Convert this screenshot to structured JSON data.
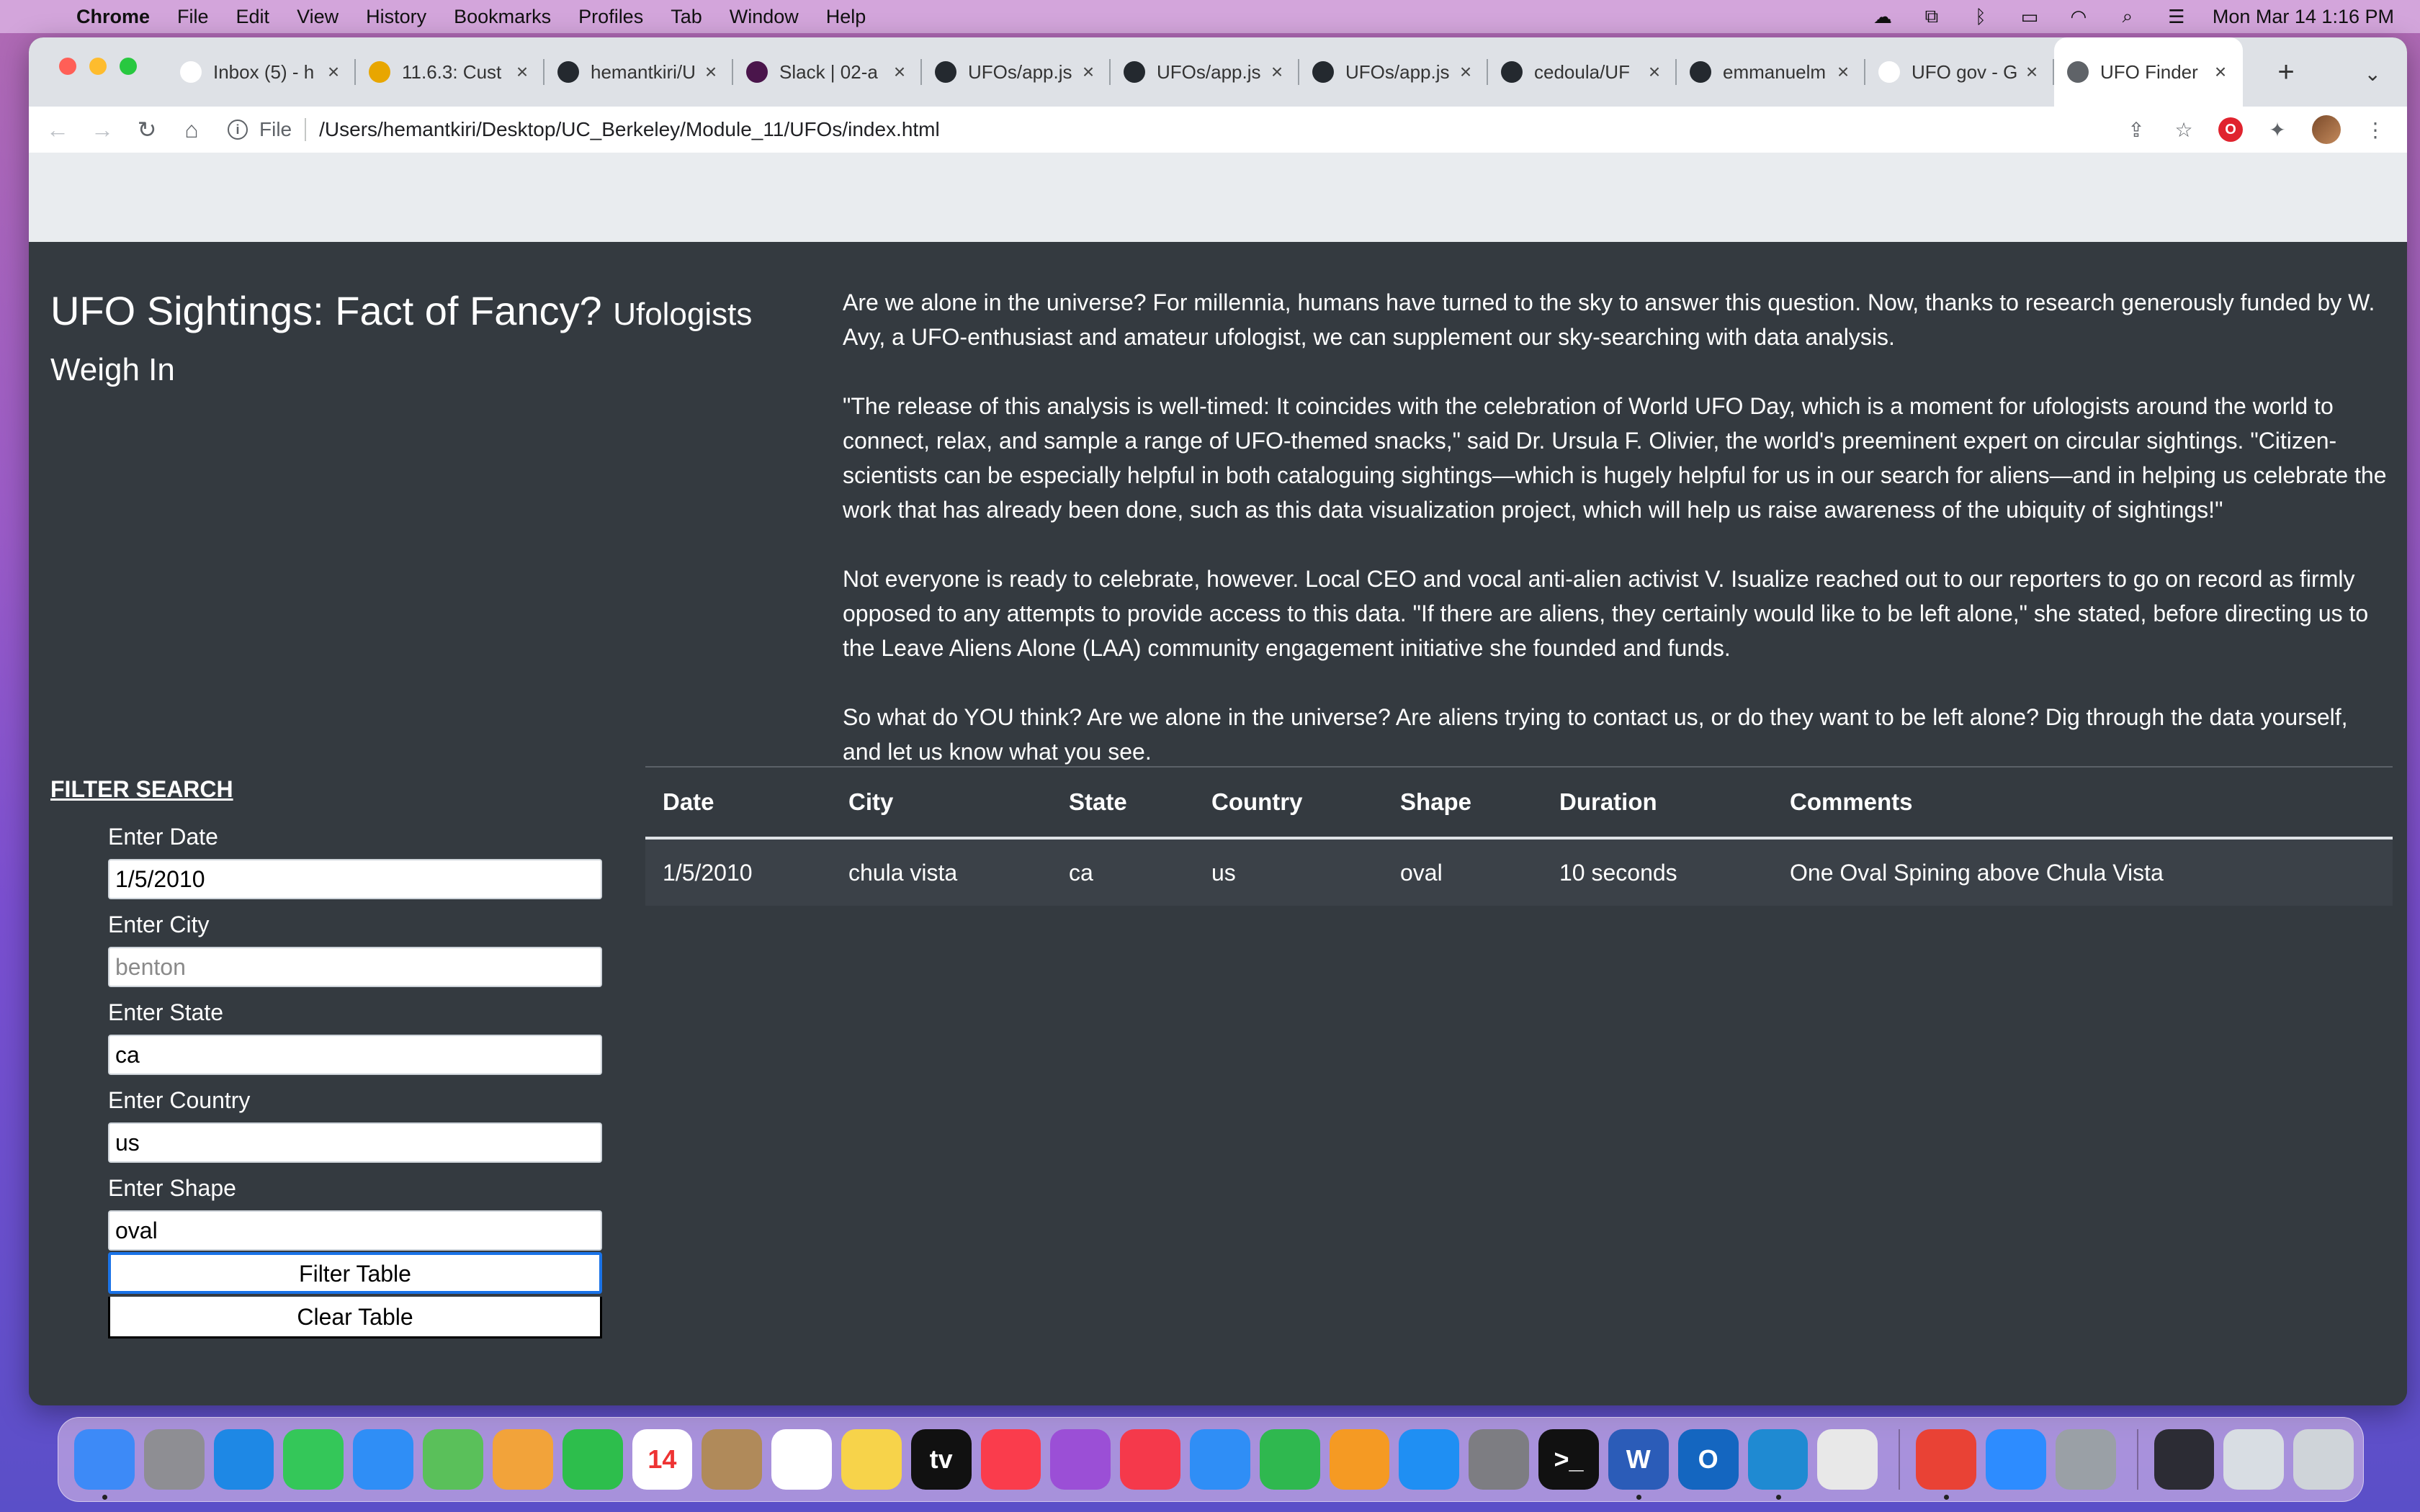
{
  "menubar": {
    "app": "Chrome",
    "items": [
      "File",
      "Edit",
      "View",
      "History",
      "Bookmarks",
      "Profiles",
      "Tab",
      "Window",
      "Help"
    ],
    "clock": "Mon Mar 14  1:16 PM"
  },
  "tabs": [
    {
      "label": "Inbox (5) - h",
      "icon": "gmail-icon",
      "color": "#ffffff"
    },
    {
      "label": "11.6.3: Cust",
      "icon": "bootcamp-icon",
      "color": "#e8a600"
    },
    {
      "label": "hemantkiri/U",
      "icon": "github-icon",
      "color": "#24292f"
    },
    {
      "label": "Slack | 02-a",
      "icon": "slack-icon",
      "color": "#4a154b"
    },
    {
      "label": "UFOs/app.js",
      "icon": "github-icon",
      "color": "#24292f"
    },
    {
      "label": "UFOs/app.js",
      "icon": "github-icon",
      "color": "#24292f"
    },
    {
      "label": "UFOs/app.js",
      "icon": "github-icon",
      "color": "#24292f"
    },
    {
      "label": "cedoula/UF",
      "icon": "github-icon",
      "color": "#24292f"
    },
    {
      "label": "emmanuelm",
      "icon": "github-icon",
      "color": "#24292f"
    },
    {
      "label": "UFO gov - G",
      "icon": "google-icon",
      "color": "#ffffff"
    },
    {
      "label": "UFO Finder",
      "icon": "globe-icon",
      "color": "#5f6368",
      "active": true
    }
  ],
  "address": {
    "scheme": "File",
    "url": "/Users/hemantkiri/Desktop/UC_Berkeley/Module_11/UFOs/index.html"
  },
  "page": {
    "title_main": "UFO Sightings: Fact of Fancy?",
    "title_sub": "Ufologists Weigh In",
    "paragraphs": [
      "Are we alone in the universe? For millennia, humans have turned to the sky to answer this question. Now, thanks to research generously funded by W. Avy, a UFO-enthusiast and amateur ufologist, we can supplement our sky-searching with data analysis.",
      "\"The release of this analysis is well-timed: It coincides with the celebration of World UFO Day, which is a moment for ufologists around the world to connect, relax, and sample a range of UFO-themed snacks,\" said Dr. Ursula F. Olivier, the world's preeminent expert on circular sightings. \"Citizen-scientists can be especially helpful in both cataloguing sightings—which is hugely helpful for us in our search for aliens—and in helping us celebrate the work that has already been done, such as this data visualization project, which will help us raise awareness of the ubiquity of sightings!\"",
      "Not everyone is ready to celebrate, however. Local CEO and vocal anti-alien activist V. Isualize reached out to our reporters to go on record as firmly opposed to any attempts to provide access to this data. \"If there are aliens, they certainly would like to be left alone,\" she stated, before directing us to the Leave Aliens Alone (LAA) community engagement initiative she founded and funds.",
      "So what do YOU think? Are we alone in the universe? Are aliens trying to contact us, or do they want to be left alone? Dig through the data yourself, and let us know what you see."
    ]
  },
  "filter": {
    "title": "FILTER SEARCH",
    "fields": [
      {
        "label": "Enter Date",
        "value": "1/5/2010",
        "placeholder": ""
      },
      {
        "label": "Enter City",
        "value": "",
        "placeholder": "benton"
      },
      {
        "label": "Enter State",
        "value": "ca",
        "placeholder": ""
      },
      {
        "label": "Enter Country",
        "value": "us",
        "placeholder": ""
      },
      {
        "label": "Enter Shape",
        "value": "oval",
        "placeholder": ""
      }
    ],
    "filter_button": "Filter Table",
    "clear_button": "Clear Table"
  },
  "table": {
    "headers": [
      "Date",
      "City",
      "State",
      "Country",
      "Shape",
      "Duration",
      "Comments"
    ],
    "rows": [
      [
        "1/5/2010",
        "chula vista",
        "ca",
        "us",
        "oval",
        "10 seconds",
        "One Oval Spining above Chula Vista"
      ]
    ]
  },
  "dock": [
    {
      "name": "finder-icon",
      "color": "#3d8af7",
      "running": true
    },
    {
      "name": "launchpad-icon",
      "color": "#8e8e93"
    },
    {
      "name": "safari-icon",
      "color": "#1e88e5"
    },
    {
      "name": "messages-icon",
      "color": "#34c759"
    },
    {
      "name": "mail-icon",
      "color": "#2f8ef6"
    },
    {
      "name": "maps-icon",
      "color": "#5ac05a"
    },
    {
      "name": "photos-icon",
      "color": "#f2a33a"
    },
    {
      "name": "facetime-icon",
      "color": "#2dbe4c"
    },
    {
      "name": "calendar-icon",
      "color": "#ffffff",
      "text": "14"
    },
    {
      "name": "contacts-icon",
      "color": "#b08a5a"
    },
    {
      "name": "reminders-icon",
      "color": "#ffffff"
    },
    {
      "name": "notes-icon",
      "color": "#f7d34a"
    },
    {
      "name": "apple-tv-icon",
      "color": "#111111",
      "text": "tv"
    },
    {
      "name": "music-icon",
      "color": "#fa3c4c"
    },
    {
      "name": "podcasts-icon",
      "color": "#9b4fd6"
    },
    {
      "name": "news-icon",
      "color": "#f5394b"
    },
    {
      "name": "keynote-icon",
      "color": "#2f8ef6"
    },
    {
      "name": "numbers-icon",
      "color": "#2fb84f"
    },
    {
      "name": "pages-icon",
      "color": "#f59a23"
    },
    {
      "name": "app-store-icon",
      "color": "#1f8ff3"
    },
    {
      "name": "system-preferences-icon",
      "color": "#7d7d82"
    },
    {
      "name": "terminal-icon",
      "color": "#111111",
      "text": ">_"
    },
    {
      "name": "word-icon",
      "color": "#2b5cb8",
      "text": "W",
      "running": true
    },
    {
      "name": "outlook-icon",
      "color": "#1466c0",
      "text": "O"
    },
    {
      "name": "vscode-icon",
      "color": "#1f8ad2",
      "running": true
    },
    {
      "name": "textedit-icon",
      "color": "#e8e8e8"
    },
    {
      "name": "chrome-icon",
      "color": "#e94235",
      "running": true,
      "sep_before": true
    },
    {
      "name": "zoom-icon",
      "color": "#2d8cff"
    },
    {
      "name": "preview-icon",
      "color": "#9aa0a6"
    },
    {
      "name": "screenshot-folder-icon",
      "color": "#2c2c34",
      "sep_before": true
    },
    {
      "name": "downloads-folder-icon",
      "color": "#d8dde3"
    },
    {
      "name": "trash-icon",
      "color": "#cfd4d9"
    }
  ]
}
